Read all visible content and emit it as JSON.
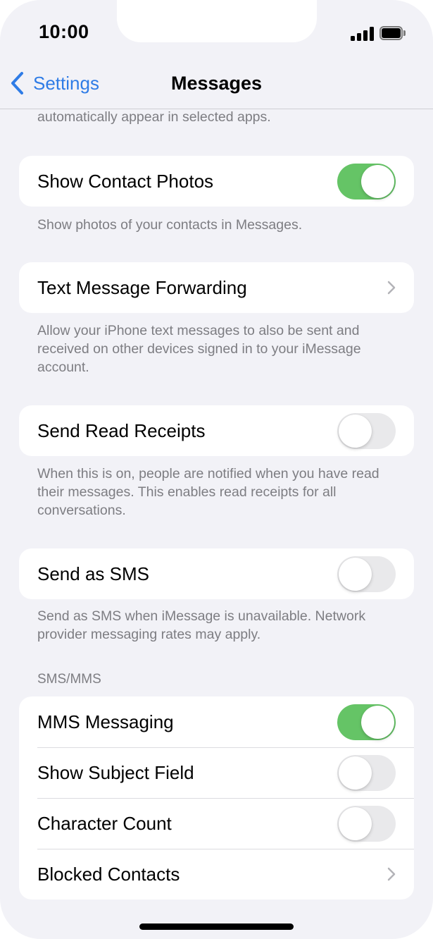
{
  "status_bar": {
    "time": "10:00",
    "signal_icon": "cellular-signal-icon",
    "battery_icon": "battery-icon"
  },
  "nav": {
    "back_label": "Settings",
    "back_icon": "chevron-left-icon",
    "title": "Messages"
  },
  "colors": {
    "accent": "#2f7ce6",
    "toggle_on": "#65c466",
    "toggle_off": "#e9e9eb",
    "background": "#f2f2f7",
    "secondary_text": "#7d7d82"
  },
  "top_footer_fragment": "automatically appear in selected apps.",
  "groups": [
    {
      "rows": [
        {
          "label": "Show Contact Photos",
          "control": "toggle",
          "on": true
        }
      ],
      "footer": "Show photos of your contacts in Messages."
    },
    {
      "rows": [
        {
          "label": "Text Message Forwarding",
          "control": "chevron"
        }
      ],
      "footer": "Allow your iPhone text messages to also be sent and received on other devices signed in to your iMessage account."
    },
    {
      "rows": [
        {
          "label": "Send Read Receipts",
          "control": "toggle",
          "on": false
        }
      ],
      "footer": "When this is on, people are notified when you have read their messages. This enables read receipts for all conversations."
    },
    {
      "rows": [
        {
          "label": "Send as SMS",
          "control": "toggle",
          "on": false
        }
      ],
      "footer": "Send as SMS when iMessage is unavailable. Network provider messaging rates may apply."
    },
    {
      "header": "SMS/MMS",
      "rows": [
        {
          "label": "MMS Messaging",
          "control": "toggle",
          "on": true
        },
        {
          "label": "Show Subject Field",
          "control": "toggle",
          "on": false
        },
        {
          "label": "Character Count",
          "control": "toggle",
          "on": false
        },
        {
          "label": "Blocked Contacts",
          "control": "chevron"
        }
      ]
    }
  ]
}
